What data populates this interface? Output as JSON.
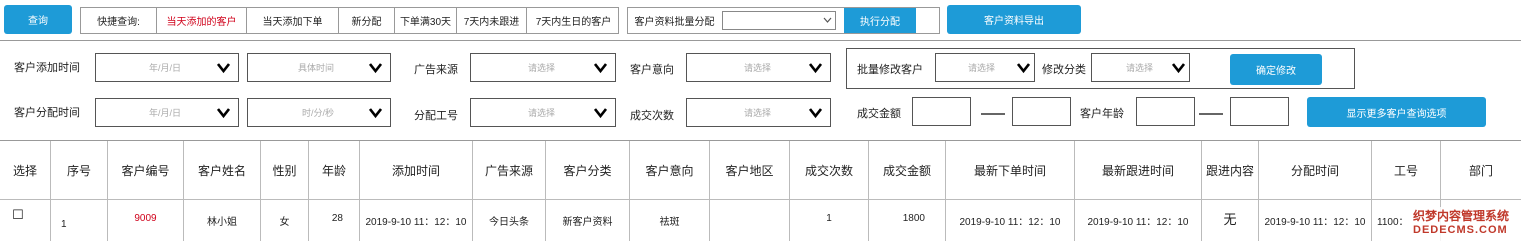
{
  "toolbar": {
    "query_button": "查询",
    "quick_query_label": "快捷查询:",
    "quick_links": [
      "当天添加的客户",
      "当天添加下单",
      "新分配",
      "下单满30天",
      "7天内未跟进",
      "7天内生日的客户"
    ],
    "batch_assign_label": "客户资料批量分配",
    "batch_assign_value": "",
    "execute_assign_button": "执行分配",
    "export_button": "客户资料导出"
  },
  "filters": {
    "add_time_label": "客户添加时间",
    "add_time_date_placeholder": "年/月/日",
    "add_time_time_placeholder": "具体时间",
    "ad_source_label": "广告来源",
    "ad_source_placeholder": "请选择",
    "intent_label": "客户意向",
    "intent_placeholder": "请选择",
    "batch_modify_label": "批量修改客户",
    "batch_modify_placeholder": "请选择",
    "modify_category_label": "修改分类",
    "modify_category_placeholder": "请选择",
    "confirm_modify_button": "确定修改",
    "assign_time_label": "客户分配时间",
    "assign_time_date_placeholder": "年/月/日",
    "assign_time_time_placeholder": "时/分/秒",
    "staff_id_label": "分配工号",
    "staff_id_placeholder": "请选择",
    "deal_count_label": "成交次数",
    "deal_count_placeholder": "请选择",
    "deal_amount_label": "成交金额",
    "age_label": "客户年龄",
    "more_options_button": "显示更多客户查询选项"
  },
  "colors": {
    "accent": "#1e9bd7",
    "highlight_text": "#d0021b"
  },
  "table": {
    "headers": [
      "选择",
      "序号",
      "客户编号",
      "客户姓名",
      "性别",
      "年龄",
      "添加时间",
      "广告来源",
      "客户分类",
      "客户意向",
      "客户地区",
      "成交次数",
      "成交金额",
      "最新下单时间",
      "最新跟进时间",
      "跟进内容",
      "分配时间",
      "工号",
      "部门"
    ],
    "rows": [
      [
        "☐",
        "1",
        "9009",
        "林小姐",
        "女",
        "28",
        "2019-9-10 11：12：10",
        "今日头条",
        "新客户资料",
        "祛斑",
        "",
        "1",
        "1800",
        "2019-9-10 11：12：10",
        "2019-9-10 11：12：10",
        "无",
        "2019-9-10 11：12：10",
        "1100：",
        ""
      ]
    ]
  },
  "watermark": {
    "line1": "织梦内容管理系统",
    "line2": "DEDECMS.COM"
  }
}
